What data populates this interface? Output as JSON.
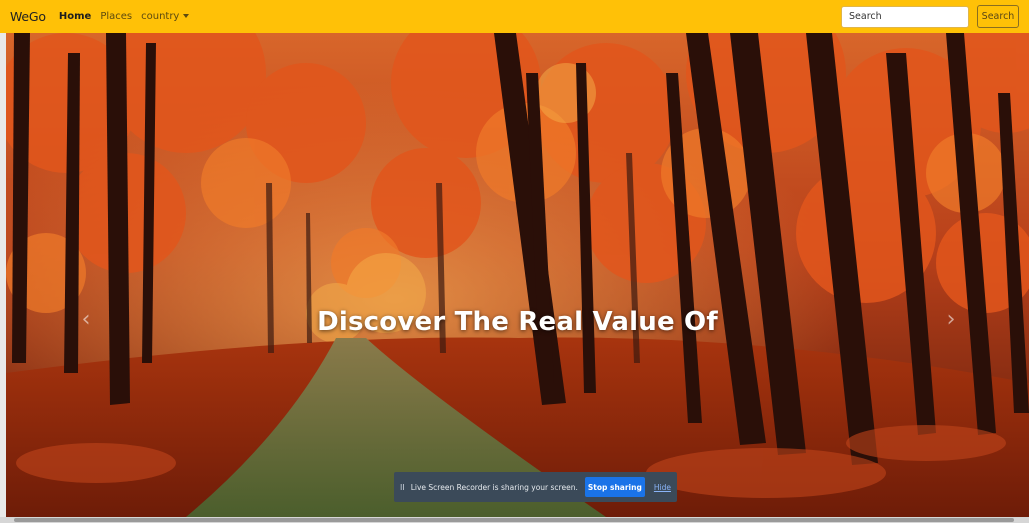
{
  "navbar": {
    "brand": "WeGo",
    "links": [
      {
        "label": "Home",
        "active": true
      },
      {
        "label": "Places",
        "active": false
      },
      {
        "label": "country",
        "active": false,
        "dropdown": true
      }
    ],
    "search": {
      "placeholder": "Search",
      "button_label": "Search"
    },
    "colors": {
      "background": "#ffc107"
    }
  },
  "hero": {
    "caption": "Discover The Real Value Of",
    "prev_icon": "chevron-left-icon",
    "next_icon": "chevron-right-icon",
    "prev_glyph": "‹",
    "next_glyph": "›"
  },
  "share_bar": {
    "pause_glyph": "II",
    "message": "Live Screen Recorder is sharing your screen.",
    "stop_label": "Stop sharing",
    "hide_label": "Hide"
  }
}
